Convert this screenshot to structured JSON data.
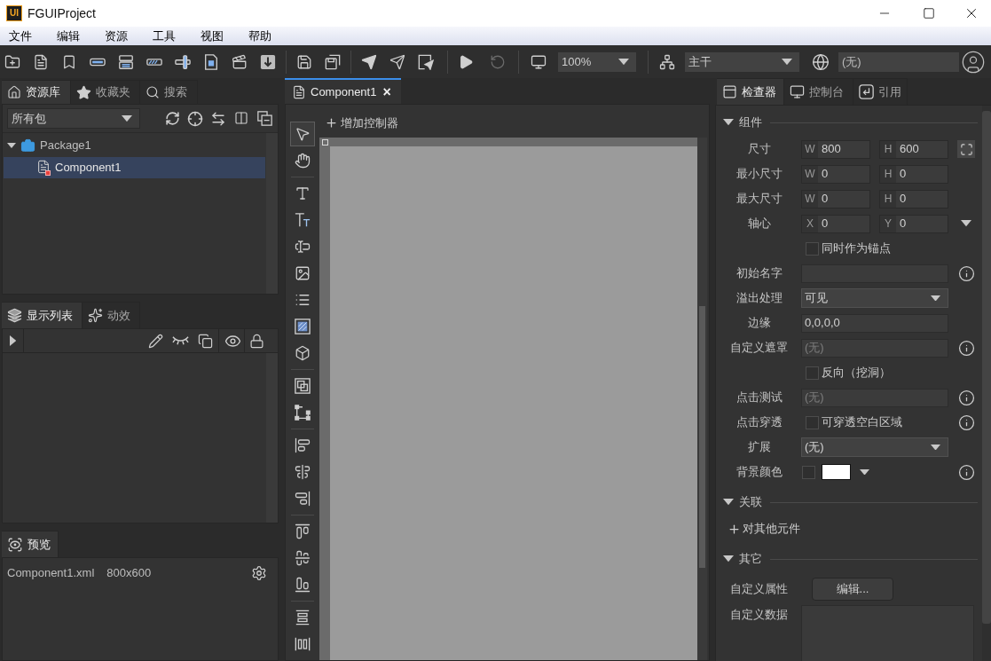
{
  "window": {
    "logo": "UI",
    "title": "FGUIProject"
  },
  "menu": [
    {
      "label": "文件"
    },
    {
      "label": "编辑"
    },
    {
      "label": "资源"
    },
    {
      "label": "工具"
    },
    {
      "label": "视图"
    },
    {
      "label": "帮助"
    }
  ],
  "toolbar": {
    "zoom": "100%",
    "branch": "主干",
    "language": "(无)"
  },
  "library": {
    "tabs": [
      {
        "label": "资源库",
        "selected": true
      },
      {
        "label": "收藏夹",
        "selected": false
      },
      {
        "label": "搜索",
        "selected": false
      }
    ],
    "filter": "所有包",
    "tree": [
      {
        "label": "Package1",
        "expanded": true,
        "selected": false,
        "children": [
          {
            "label": "Component1",
            "selected": true
          }
        ]
      }
    ]
  },
  "display_list": {
    "tabs": [
      {
        "label": "显示列表",
        "selected": true
      },
      {
        "label": "动效",
        "selected": false
      }
    ]
  },
  "preview": {
    "tabs": [
      {
        "label": "预览",
        "selected": true
      }
    ],
    "file": "Component1.xml",
    "size": "800x600"
  },
  "editor": {
    "tabs": [
      {
        "label": "Component1",
        "close": "×",
        "selected": true
      }
    ],
    "add_controller": "增加控制器",
    "tool_groups": [
      [
        {
          "selected": true
        },
        {
          "selected": false
        }
      ],
      [
        {
          "selected": false
        },
        {
          "selected": false
        },
        {
          "selected": false
        },
        {
          "selected": false
        },
        {
          "selected": false
        },
        {
          "selected": false
        },
        {
          "selected": false
        }
      ],
      [
        {
          "selected": false
        },
        {
          "selected": false
        }
      ],
      [
        {
          "selected": false
        },
        {
          "selected": false
        },
        {
          "selected": false
        }
      ],
      [
        {
          "selected": false
        },
        {
          "selected": false
        },
        {
          "selected": false
        }
      ],
      [
        {
          "selected": false
        },
        {
          "selected": false
        }
      ]
    ]
  },
  "inspector": {
    "tabs": [
      {
        "label": "检查器",
        "selected": true
      },
      {
        "label": "控制台",
        "selected": false
      },
      {
        "label": "引用",
        "selected": false
      }
    ],
    "sections": [
      {
        "title": "组件",
        "expanded": true,
        "rows": [
          {
            "kind": "size",
            "label": "尺寸",
            "info": false,
            "a": {
              "prefix": "W",
              "value": "800"
            },
            "b": {
              "prefix": "H",
              "value": "600"
            }
          },
          {
            "kind": "pair",
            "label": "最小尺寸",
            "info": false,
            "a": {
              "prefix": "W",
              "value": "0"
            },
            "b": {
              "prefix": "H",
              "value": "0"
            }
          },
          {
            "kind": "pair",
            "label": "最大尺寸",
            "info": false,
            "a": {
              "prefix": "W",
              "value": "0"
            },
            "b": {
              "prefix": "H",
              "value": "0"
            }
          },
          {
            "kind": "pivot",
            "label": "轴心",
            "info": false,
            "a": {
              "prefix": "X",
              "value": "0"
            },
            "b": {
              "prefix": "Y",
              "value": "0"
            }
          },
          {
            "kind": "check",
            "text": "同时作为锚点",
            "checked": false,
            "info": false
          },
          {
            "kind": "text",
            "label": "初始名字",
            "info": true
          },
          {
            "kind": "select",
            "label": "溢出处理",
            "value": "可见",
            "info": false
          },
          {
            "kind": "text",
            "label": "边缘",
            "value": "0,0,0,0",
            "info": false
          },
          {
            "kind": "text",
            "label": "自定义遮罩",
            "placeholder": "(无)",
            "info": true
          },
          {
            "kind": "check",
            "text": "反向（挖洞）",
            "checked": false,
            "info": false
          },
          {
            "kind": "text",
            "label": "点击测试",
            "placeholder": "(无)",
            "info": true
          },
          {
            "kind": "check",
            "label": "点击穿透",
            "text": "可穿透空白区域",
            "checked": false,
            "info": true
          },
          {
            "kind": "select",
            "label": "扩展",
            "value": "(无)",
            "info": false
          },
          {
            "kind": "color",
            "label": "背景颜色",
            "checked": false,
            "color": "#ffffff",
            "info": true
          }
        ]
      },
      {
        "title": "关联",
        "expanded": true,
        "rows": [
          {
            "kind": "add",
            "text": "对其他元件",
            "info": false
          }
        ]
      },
      {
        "title": "其它",
        "expanded": true,
        "rows": [
          {
            "kind": "button",
            "label": "自定义属性",
            "text": "编辑...",
            "info": false
          },
          {
            "kind": "area",
            "label": "自定义数据",
            "info": false
          }
        ]
      }
    ]
  }
}
